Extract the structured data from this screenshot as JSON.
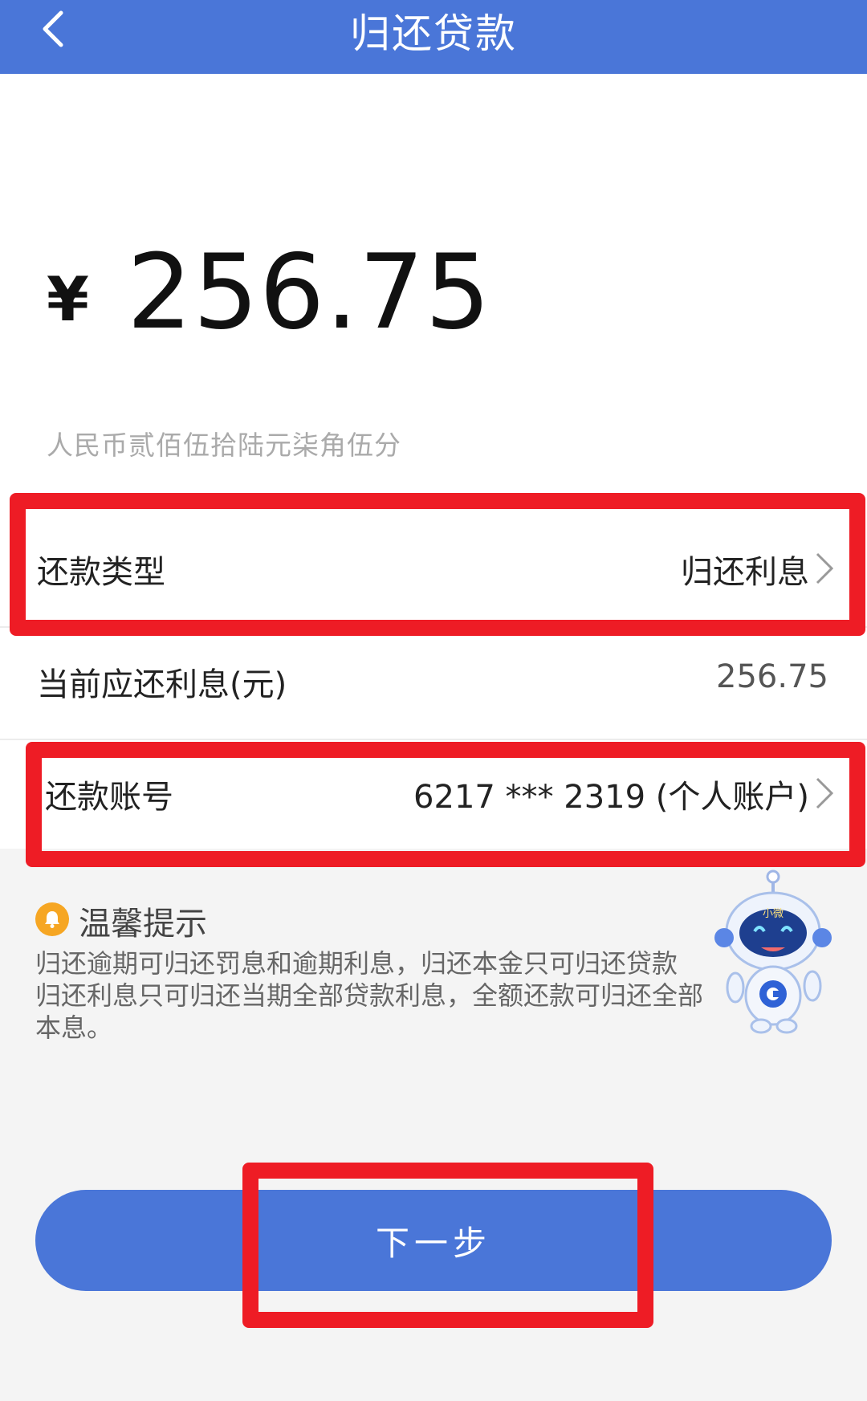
{
  "header": {
    "title": "归还贷款"
  },
  "amount": {
    "currency_symbol": "¥",
    "value": "256.75",
    "in_words": "人民币贰佰伍拾陆元柒角伍分"
  },
  "rows": {
    "repay_type": {
      "label": "还款类型",
      "value": "归还利息"
    },
    "current_interest": {
      "label": "当前应还利息(元)",
      "value": "256.75"
    },
    "account": {
      "label": "还款账号",
      "value": "6217 *** 2319 (个人账户)"
    }
  },
  "tips": {
    "title": "温馨提示",
    "body": "归还逾期可归还罚息和逾期利息，归还本金只可归还贷款\n归还利息只可归还当期全部贷款利息，全额还款可归还全部\n本息。"
  },
  "mascot": {
    "badge": "小微"
  },
  "next_button": {
    "label": "下一步"
  },
  "colors": {
    "header_bg": "#4a76d8",
    "button_bg": "#4a76d8",
    "highlight": "#ee1c25",
    "bell": "#f6a623"
  },
  "icons": {
    "back": "chevron-left-icon",
    "row_arrow": "chevron-right-icon",
    "bell": "bell-icon",
    "mascot": "robot-mascot-icon"
  }
}
